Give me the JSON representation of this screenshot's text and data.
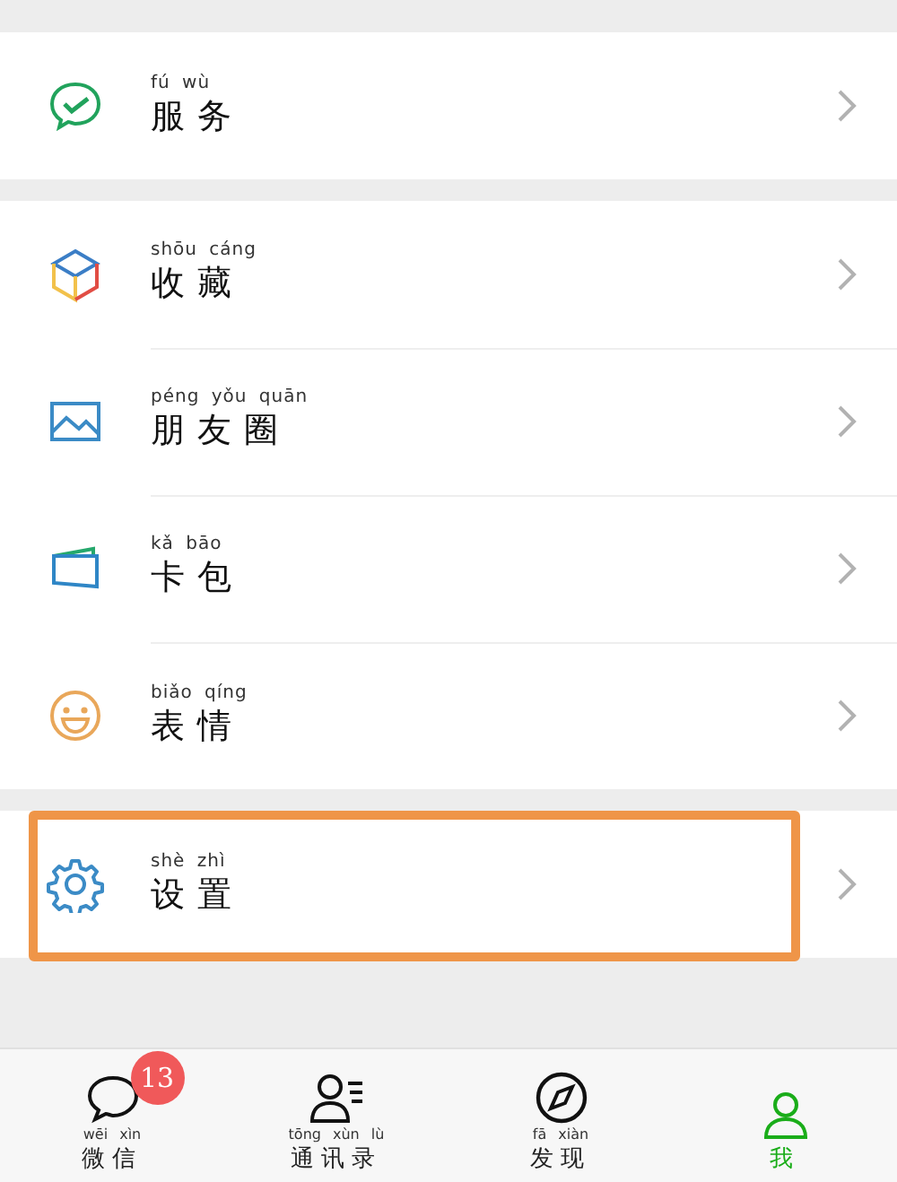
{
  "menu_sections": [
    {
      "items": [
        {
          "pinyin": "fú wù",
          "label": "服务",
          "highlighted": false
        }
      ]
    },
    {
      "items": [
        {
          "pinyin": "shōu cáng",
          "label": "收藏",
          "highlighted": false
        },
        {
          "pinyin": "péng yǒu quān",
          "label": "朋友圈",
          "highlighted": false
        },
        {
          "pinyin": "kǎ bāo",
          "label": "卡包",
          "highlighted": false
        },
        {
          "pinyin": "biǎo qíng",
          "label": "表情",
          "highlighted": false
        }
      ]
    },
    {
      "items": [
        {
          "pinyin": "shè zhì",
          "label": "设置",
          "highlighted": true
        }
      ]
    }
  ],
  "tab_bar": [
    {
      "pinyin": "wēi xìn",
      "label": "微信",
      "badge": "13",
      "selected": false
    },
    {
      "pinyin": "tōng xùn lù",
      "label": "通讯录",
      "selected": false
    },
    {
      "pinyin": "fā xiàn",
      "label": "发现",
      "selected": false
    },
    {
      "label": "我",
      "selected": true
    }
  ]
}
